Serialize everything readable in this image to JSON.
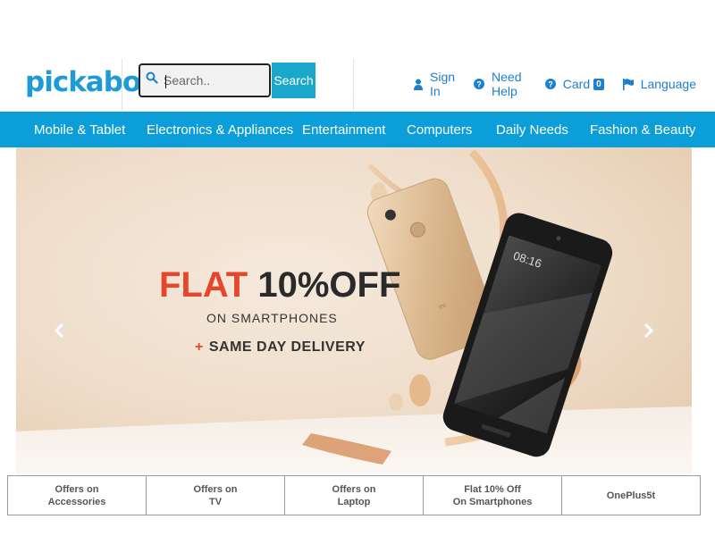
{
  "brand": {
    "logo_text": "pickaboo",
    "color": "#1d9bd7"
  },
  "search": {
    "placeholder": "Search..",
    "button_label": "Search",
    "icon": "search-icon"
  },
  "top_links": [
    {
      "label": "Sign In",
      "icon": "user-icon"
    },
    {
      "label": "Need Help",
      "icon": "help-icon"
    },
    {
      "label": "Card",
      "icon": "help-icon",
      "badge": "0"
    },
    {
      "label": "Language",
      "icon": "flag-icon"
    }
  ],
  "nav": {
    "items": [
      "Mobile & Tablet",
      "Electronics & Appliances",
      "Entertainment",
      "Computers",
      "Daily Needs",
      "Fashion & Beauty"
    ],
    "background": "#0c9ed8"
  },
  "banner": {
    "title_accent": "FLAT",
    "title_rest": "10%OFF",
    "subtitle": "ON SMARTPHONES",
    "extra": "SAME DAY DELIVERY",
    "accent_color": "#e6462c",
    "phone_time": "08:16"
  },
  "offers": [
    {
      "label": "Offers on\nAccessories"
    },
    {
      "label": "Offers on\nTV"
    },
    {
      "label": "Offers on\nLaptop"
    },
    {
      "label": "Flat 10% Off\nOn Smartphones"
    },
    {
      "label": "OnePlus5t"
    }
  ]
}
